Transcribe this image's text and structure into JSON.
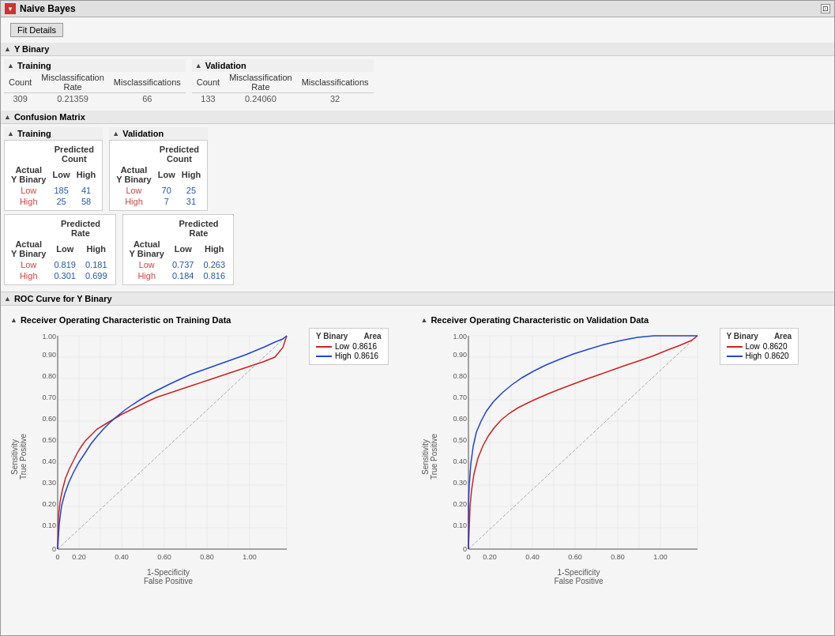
{
  "window": {
    "title": "Naive Bayes"
  },
  "fitDetails": {
    "label": "Fit Details"
  },
  "yBinary": {
    "label": "Y Binary",
    "training": {
      "label": "Training",
      "count": "309",
      "misclassRate": "0.21359",
      "misclassifications": "66"
    },
    "validation": {
      "label": "Validation",
      "count": "133",
      "misclassRate": "0.24060",
      "misclassifications": "32"
    }
  },
  "confusionMatrix": {
    "label": "Confusion Matrix",
    "training": {
      "label": "Training",
      "countTable": {
        "header": [
          "Actual Y Binary",
          "Predicted Count Low",
          "Predicted Count High"
        ],
        "rows": [
          {
            "label": "Low",
            "low": "185",
            "high": "41"
          },
          {
            "label": "High",
            "low": "25",
            "high": "58"
          }
        ]
      },
      "rateTable": {
        "header": [
          "Actual Y Binary",
          "Predicted Rate Low",
          "Predicted Rate High"
        ],
        "rows": [
          {
            "label": "Low",
            "low": "0.819",
            "high": "0.181"
          },
          {
            "label": "High",
            "low": "0.301",
            "high": "0.699"
          }
        ]
      }
    },
    "validation": {
      "label": "Validation",
      "countTable": {
        "rows": [
          {
            "label": "Low",
            "low": "70",
            "high": "25"
          },
          {
            "label": "High",
            "low": "7",
            "high": "31"
          }
        ]
      },
      "rateTable": {
        "rows": [
          {
            "label": "Low",
            "low": "0.737",
            "high": "0.263"
          },
          {
            "label": "High",
            "low": "0.184",
            "high": "0.816"
          }
        ]
      }
    }
  },
  "rocCurve": {
    "sectionLabel": "ROC Curve for Y Binary",
    "training": {
      "title": "Receiver Operating Characteristic on Training Data",
      "legend": {
        "col1": "Y Binary",
        "col2": "Area",
        "rows": [
          {
            "label": "Low",
            "area": "0.8616"
          },
          {
            "label": "High",
            "area": "0.8616"
          }
        ]
      }
    },
    "validation": {
      "title": "Receiver Operating Characteristic on Validation Data",
      "legend": {
        "col1": "Y Binary",
        "col2": "Area",
        "rows": [
          {
            "label": "Low",
            "area": "0.8620"
          },
          {
            "label": "High",
            "area": "0.8620"
          }
        ]
      }
    },
    "yAxisLabel": "Sensitivity\nTrue Positive",
    "xAxisLabel": "1-Specificity\nFalse Positive"
  }
}
